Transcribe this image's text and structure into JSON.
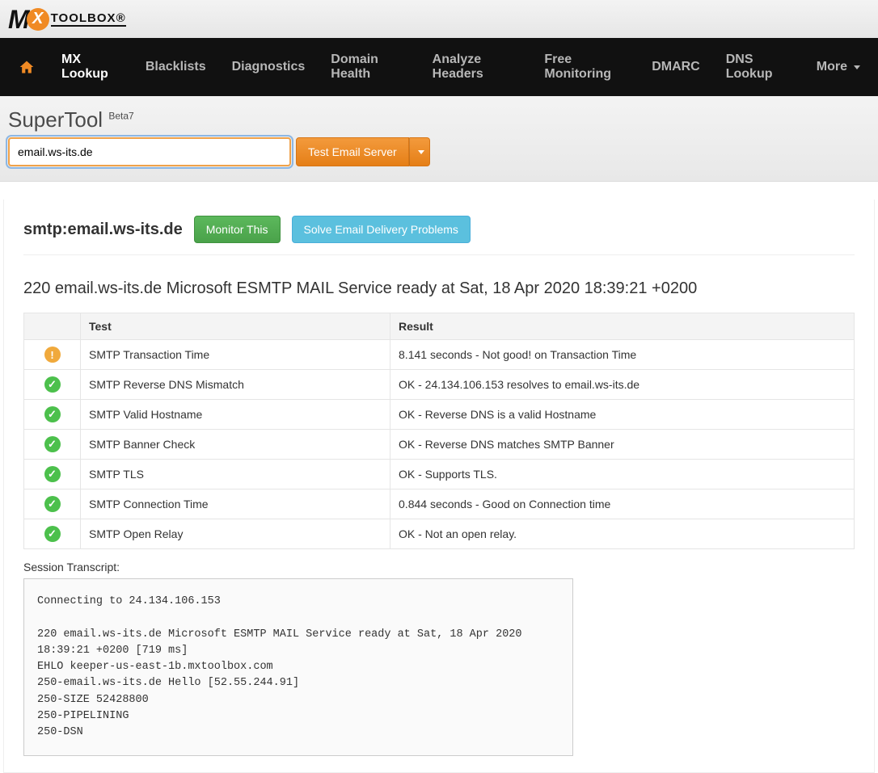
{
  "brand": {
    "toolbox_text": "TOOLBOX",
    "reg": "®"
  },
  "nav": {
    "mx_lookup": "MX Lookup",
    "blacklists": "Blacklists",
    "diagnostics": "Diagnostics",
    "domain_health": "Domain Health",
    "analyze_headers": "Analyze Headers",
    "free_monitoring": "Free Monitoring",
    "dmarc": "DMARC",
    "dns_lookup": "DNS Lookup",
    "more": "More"
  },
  "supertool": {
    "title": "SuperTool",
    "beta": "Beta7",
    "input_value": "email.ws-its.de",
    "test_btn": "Test Email Server"
  },
  "result": {
    "heading": "smtp:email.ws-its.de",
    "monitor_btn": "Monitor This",
    "solve_btn": "Solve Email Delivery Problems",
    "banner": "220 email.ws-its.de Microsoft ESMTP MAIL Service ready at Sat, 18 Apr 2020 18:39:21 +0200",
    "th_test": "Test",
    "th_result": "Result",
    "rows": [
      {
        "status": "warn",
        "test": "SMTP Transaction Time",
        "result": "8.141 seconds - Not good! on Transaction Time"
      },
      {
        "status": "ok",
        "test": "SMTP Reverse DNS Mismatch",
        "result": "OK - 24.134.106.153 resolves to email.ws-its.de"
      },
      {
        "status": "ok",
        "test": "SMTP Valid Hostname",
        "result": "OK - Reverse DNS is a valid Hostname"
      },
      {
        "status": "ok",
        "test": "SMTP Banner Check",
        "result": "OK - Reverse DNS matches SMTP Banner"
      },
      {
        "status": "ok",
        "test": "SMTP TLS",
        "result": "OK - Supports TLS."
      },
      {
        "status": "ok",
        "test": "SMTP Connection Time",
        "result": "0.844 seconds - Good on Connection time"
      },
      {
        "status": "ok",
        "test": "SMTP Open Relay",
        "result": "OK - Not an open relay."
      }
    ],
    "session_label": "Session Transcript:",
    "session_transcript": "Connecting to 24.134.106.153\n\n220 email.ws-its.de Microsoft ESMTP MAIL Service ready at Sat, 18 Apr 2020 18:39:21 +0200 [719 ms]\nEHLO keeper-us-east-1b.mxtoolbox.com\n250-email.ws-its.de Hello [52.55.244.91]\n250-SIZE 52428800\n250-PIPELINING\n250-DSN"
  }
}
